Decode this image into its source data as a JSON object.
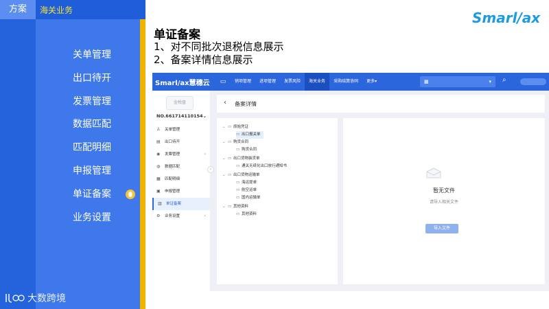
{
  "left_panel": {
    "tab_solution": "方案",
    "tab_customs": "海关业务",
    "menu": [
      "关单管理",
      "出口待开",
      "发票管理",
      "数据匹配",
      "匹配明细",
      "申报管理",
      "单证备案",
      "业务设置"
    ],
    "active_index": 6,
    "brand_bottom": "大数跨境"
  },
  "slide": {
    "title": "单证备案",
    "line1": "1、对不同批次退税信息展示",
    "line2": "2、备案详情信息展示",
    "brand_logo": "Smarl/ax"
  },
  "app": {
    "logo": "Smarl/ax慧穗云",
    "nav": [
      "销项管理",
      "进项管理",
      "发票风险",
      "海关业务",
      "采购结算协同",
      "更多"
    ],
    "nav_active_index": 3,
    "nav_more_caret": "▾",
    "sidebar": {
      "seal": "金税盘",
      "company_id": "NO.661714110154",
      "items": [
        {
          "label": "关单管理",
          "icon": "♙",
          "chev": ""
        },
        {
          "label": "出口待开",
          "icon": "▤",
          "chev": ""
        },
        {
          "label": "发票管理",
          "icon": "◉",
          "chev": "›"
        },
        {
          "label": "数据匹配",
          "icon": "◍",
          "chev": ""
        },
        {
          "label": "匹配明细",
          "icon": "▦",
          "chev": ""
        },
        {
          "label": "申报管理",
          "icon": "▣",
          "chev": ""
        },
        {
          "label": "单证备案",
          "icon": "▥",
          "chev": ""
        },
        {
          "label": "业务设置",
          "icon": "⚙",
          "chev": "›"
        }
      ],
      "active_index": 6
    },
    "breadcrumb": "备案详情",
    "tree": [
      {
        "label": "原始凭证",
        "level": 0
      },
      {
        "label": "出口报关单",
        "level": 1,
        "selected": true
      },
      {
        "label": "购货合同",
        "level": 0
      },
      {
        "label": "购货合同",
        "level": 1
      },
      {
        "label": "出口货物装货单",
        "level": 0
      },
      {
        "label": "通关无纸化出口放行通知书",
        "level": 1
      },
      {
        "label": "出口货物运输单",
        "level": 0
      },
      {
        "label": "海运提单",
        "level": 1
      },
      {
        "label": "航空运单",
        "level": 1
      },
      {
        "label": "国内运输单",
        "level": 1
      },
      {
        "label": "其他资料",
        "level": 0
      },
      {
        "label": "其他资料",
        "level": 1
      }
    ],
    "empty": {
      "title": "暂无文件",
      "subtitle": "请导入相关文件",
      "import_button": "导入文件"
    }
  }
}
